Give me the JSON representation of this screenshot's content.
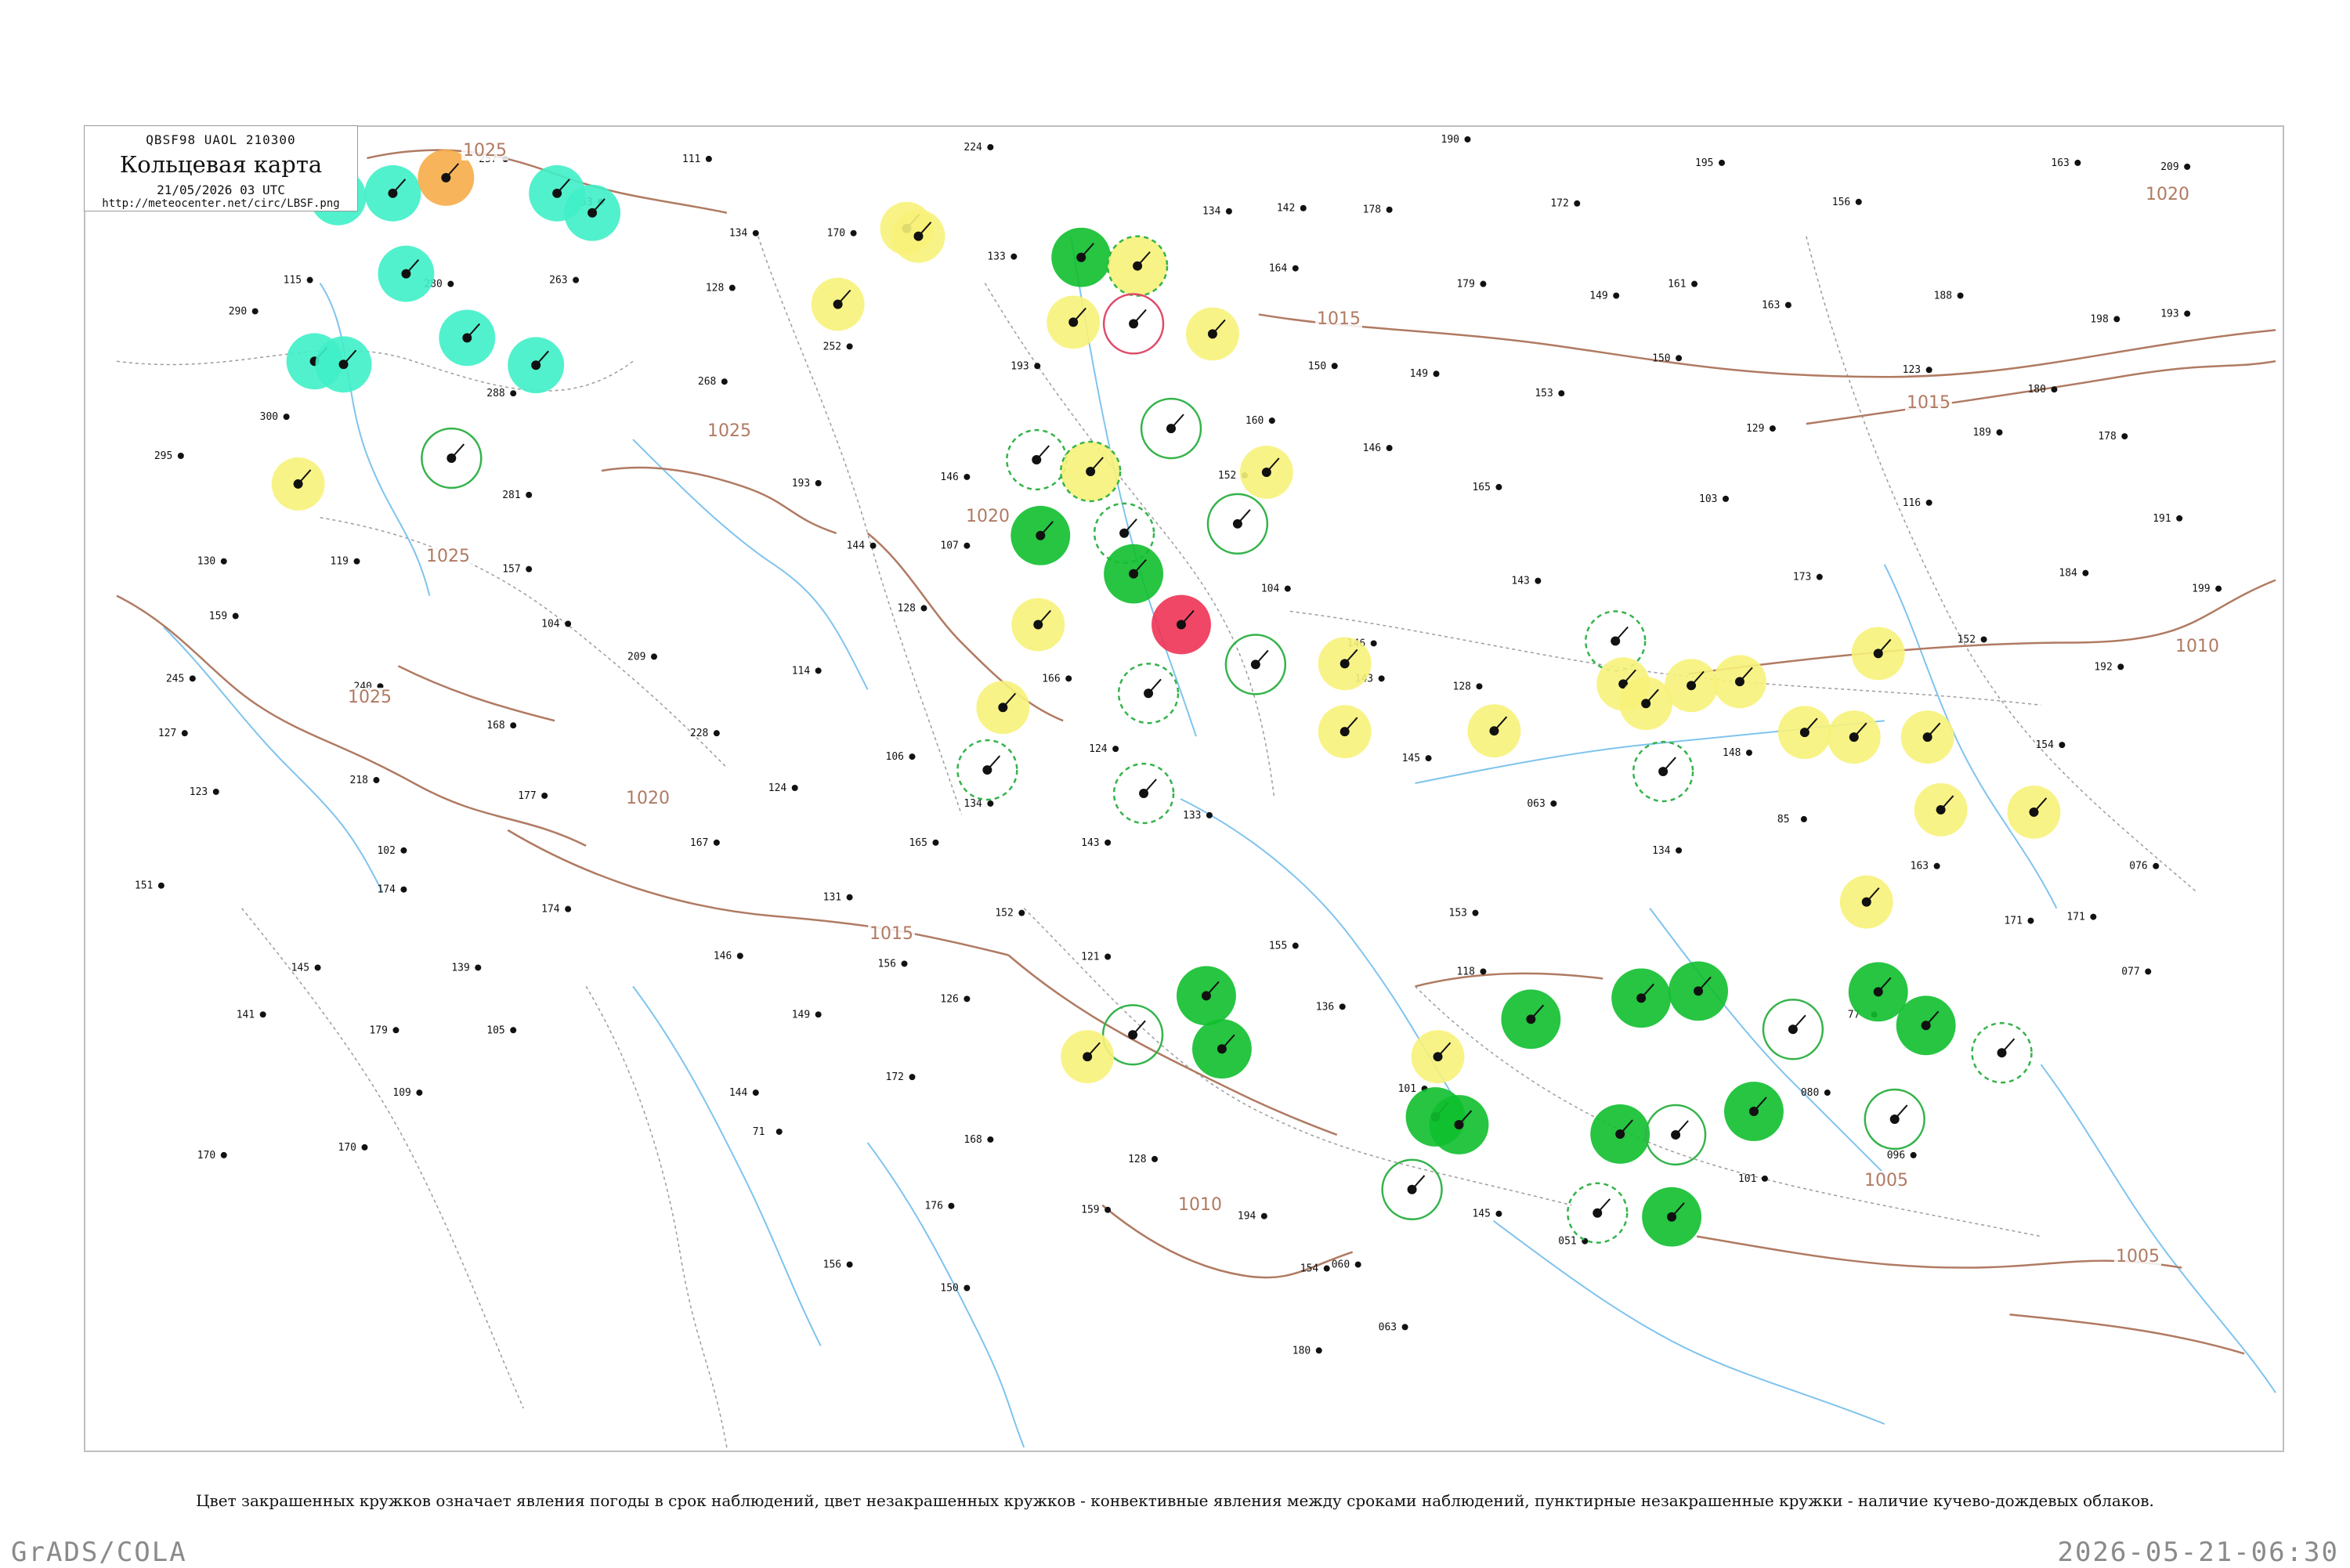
{
  "header": {
    "code_line": "QBSF98  UAOL  210300",
    "title": "Кольцевая карта",
    "date_line": "21/05/2026 03 UTC",
    "url": "http://meteocenter.net/circ/LBSF.png"
  },
  "caption": "Цвет закрашенных кружков означает явления погоды в срок наблюдений, цвет незакрашенных кружков - конвективные явления между сроками наблюдений, пунктирные незакрашенные кружки - наличие кучево-дождевых облаков.",
  "footer": {
    "left": "GrADS/COLA",
    "right": "2026-05-21-06:30"
  },
  "colors": {
    "isobar": "#b07a62",
    "river": "#7fc4ee",
    "border": "#9c9c9c",
    "green_fill": "#0fbf2e",
    "yellow_fill": "#f7f27a",
    "teal_fill": "#3ff0c8",
    "orange_fill": "#f6ac48",
    "red_fill": "#ee3355",
    "green_ring": "#34b34a",
    "red_ring": "#e04a6a"
  },
  "isobars": [
    {
      "label": "1025"
    },
    {
      "label": "1025"
    },
    {
      "label": "1025"
    },
    {
      "label": "1025"
    },
    {
      "label": "1020"
    },
    {
      "label": "1020"
    },
    {
      "label": "1020"
    },
    {
      "label": "1015"
    },
    {
      "label": "1015"
    },
    {
      "label": "1015"
    },
    {
      "label": "1010"
    },
    {
      "label": "1010"
    },
    {
      "label": "1005"
    },
    {
      "label": "1005"
    }
  ],
  "station_markers": [
    {
      "lon": 430,
      "lat": 250,
      "kind": "teal"
    },
    {
      "lon": 500,
      "lat": 245,
      "kind": "teal"
    },
    {
      "lon": 568,
      "lat": 225,
      "kind": "orange"
    },
    {
      "lon": 710,
      "lat": 245,
      "kind": "teal"
    },
    {
      "lon": 755,
      "lat": 270,
      "kind": "teal"
    },
    {
      "lon": 517,
      "lat": 348,
      "kind": "teal"
    },
    {
      "lon": 400,
      "lat": 460,
      "kind": "teal"
    },
    {
      "lon": 437,
      "lat": 464,
      "kind": "teal"
    },
    {
      "lon": 595,
      "lat": 430,
      "kind": "teal"
    },
    {
      "lon": 683,
      "lat": 465,
      "kind": "teal"
    },
    {
      "lon": 575,
      "lat": 584,
      "kind": "green_ring"
    },
    {
      "lon": 379,
      "lat": 617,
      "kind": "yellow"
    },
    {
      "lon": 1069,
      "lat": 387,
      "kind": "yellow"
    },
    {
      "lon": 1157,
      "lat": 290,
      "kind": "yellow"
    },
    {
      "lon": 1172,
      "lat": 300,
      "kind": "yellow"
    },
    {
      "lon": 1380,
      "lat": 327,
      "kind": "green"
    },
    {
      "lon": 1452,
      "lat": 338,
      "kind": "yellow_ring"
    },
    {
      "lon": 1370,
      "lat": 410,
      "kind": "yellow"
    },
    {
      "lon": 1447,
      "lat": 412,
      "kind": "red_ring"
    },
    {
      "lon": 1548,
      "lat": 425,
      "kind": "yellow"
    },
    {
      "lon": 1495,
      "lat": 546,
      "kind": "green_ring"
    },
    {
      "lon": 1617,
      "lat": 602,
      "kind": "yellow"
    },
    {
      "lon": 1323,
      "lat": 586,
      "kind": "green_dash"
    },
    {
      "lon": 1392,
      "lat": 601,
      "kind": "yellow_ring"
    },
    {
      "lon": 1328,
      "lat": 683,
      "kind": "green"
    },
    {
      "lon": 1435,
      "lat": 680,
      "kind": "green_dash"
    },
    {
      "lon": 1447,
      "lat": 732,
      "kind": "green"
    },
    {
      "lon": 1580,
      "lat": 668,
      "kind": "green_ring"
    },
    {
      "lon": 1508,
      "lat": 797,
      "kind": "red"
    },
    {
      "lon": 1325,
      "lat": 797,
      "kind": "yellow"
    },
    {
      "lon": 1280,
      "lat": 903,
      "kind": "yellow"
    },
    {
      "lon": 1466,
      "lat": 885,
      "kind": "green_dash"
    },
    {
      "lon": 1603,
      "lat": 848,
      "kind": "green_ring"
    },
    {
      "lon": 1717,
      "lat": 847,
      "kind": "yellow"
    },
    {
      "lon": 1717,
      "lat": 934,
      "kind": "yellow"
    },
    {
      "lon": 1908,
      "lat": 933,
      "kind": "yellow"
    },
    {
      "lon": 2063,
      "lat": 818,
      "kind": "green_dash"
    },
    {
      "lon": 2073,
      "lat": 873,
      "kind": "yellow"
    },
    {
      "lon": 2102,
      "lat": 898,
      "kind": "yellow"
    },
    {
      "lon": 2160,
      "lat": 875,
      "kind": "yellow"
    },
    {
      "lon": 2222,
      "lat": 870,
      "kind": "yellow"
    },
    {
      "lon": 2305,
      "lat": 935,
      "kind": "yellow"
    },
    {
      "lon": 2399,
      "lat": 834,
      "kind": "yellow"
    },
    {
      "lon": 2368,
      "lat": 941,
      "kind": "yellow"
    },
    {
      "lon": 2462,
      "lat": 941,
      "kind": "yellow"
    },
    {
      "lon": 2124,
      "lat": 985,
      "kind": "green_dash"
    },
    {
      "lon": 2598,
      "lat": 1037,
      "kind": "yellow"
    },
    {
      "lon": 2479,
      "lat": 1034,
      "kind": "yellow"
    },
    {
      "lon": 1260,
      "lat": 983,
      "kind": "green_dash"
    },
    {
      "lon": 1460,
      "lat": 1013,
      "kind": "green_dash"
    },
    {
      "lon": 2384,
      "lat": 1152,
      "kind": "yellow"
    },
    {
      "lon": 1540,
      "lat": 1272,
      "kind": "green"
    },
    {
      "lon": 1560,
      "lat": 1340,
      "kind": "green"
    },
    {
      "lon": 1446,
      "lat": 1322,
      "kind": "green_ring"
    },
    {
      "lon": 1388,
      "lat": 1350,
      "kind": "yellow"
    },
    {
      "lon": 1836,
      "lat": 1350,
      "kind": "yellow"
    },
    {
      "lon": 1955,
      "lat": 1302,
      "kind": "green"
    },
    {
      "lon": 2096,
      "lat": 1275,
      "kind": "green"
    },
    {
      "lon": 2169,
      "lat": 1266,
      "kind": "green"
    },
    {
      "lon": 2399,
      "lat": 1267,
      "kind": "green"
    },
    {
      "lon": 2460,
      "lat": 1310,
      "kind": "green"
    },
    {
      "lon": 2557,
      "lat": 1345,
      "kind": "green_dash"
    },
    {
      "lon": 2290,
      "lat": 1315,
      "kind": "green_ring"
    },
    {
      "lon": 1833,
      "lat": 1427,
      "kind": "green"
    },
    {
      "lon": 1863,
      "lat": 1437,
      "kind": "green"
    },
    {
      "lon": 2240,
      "lat": 1420,
      "kind": "green"
    },
    {
      "lon": 2069,
      "lat": 1449,
      "kind": "green"
    },
    {
      "lon": 2140,
      "lat": 1450,
      "kind": "green_ring"
    },
    {
      "lon": 2420,
      "lat": 1430,
      "kind": "green_ring"
    },
    {
      "lon": 1803,
      "lat": 1520,
      "kind": "green_ring"
    },
    {
      "lon": 2040,
      "lat": 1550,
      "kind": "green_dash"
    },
    {
      "lon": 2135,
      "lat": 1555,
      "kind": "green"
    }
  ],
  "station_labels": [
    {
      "lon": 610,
      "lat": 205,
      "text": "257"
    },
    {
      "lon": 732,
      "lat": 260,
      "text": "263"
    },
    {
      "lon": 870,
      "lat": 205,
      "text": "111"
    },
    {
      "lon": 1230,
      "lat": 190,
      "text": "224"
    },
    {
      "lon": 1840,
      "lat": 180,
      "text": "190"
    },
    {
      "lon": 2165,
      "lat": 210,
      "text": "195"
    },
    {
      "lon": 2620,
      "lat": 210,
      "text": "163"
    },
    {
      "lon": 2760,
      "lat": 215,
      "text": "209"
    },
    {
      "lon": 1535,
      "lat": 272,
      "text": "134"
    },
    {
      "lon": 1630,
      "lat": 268,
      "text": "142"
    },
    {
      "lon": 1740,
      "lat": 270,
      "text": "178"
    },
    {
      "lon": 1980,
      "lat": 262,
      "text": "172"
    },
    {
      "lon": 2340,
      "lat": 260,
      "text": "156"
    },
    {
      "lon": 930,
      "lat": 300,
      "text": "134"
    },
    {
      "lon": 1055,
      "lat": 300,
      "text": "170"
    },
    {
      "lon": 1260,
      "lat": 330,
      "text": "133"
    },
    {
      "lon": 360,
      "lat": 360,
      "text": "115"
    },
    {
      "lon": 540,
      "lat": 365,
      "text": "280"
    },
    {
      "lon": 700,
      "lat": 360,
      "text": "263"
    },
    {
      "lon": 900,
      "lat": 370,
      "text": "128"
    },
    {
      "lon": 1620,
      "lat": 345,
      "text": "164"
    },
    {
      "lon": 1860,
      "lat": 365,
      "text": "179"
    },
    {
      "lon": 2030,
      "lat": 380,
      "text": "149"
    },
    {
      "lon": 2130,
      "lat": 365,
      "text": "161"
    },
    {
      "lon": 2250,
      "lat": 392,
      "text": "163"
    },
    {
      "lon": 2470,
      "lat": 380,
      "text": "188"
    },
    {
      "lon": 2670,
      "lat": 410,
      "text": "198"
    },
    {
      "lon": 2760,
      "lat": 403,
      "text": "193"
    },
    {
      "lon": 290,
      "lat": 400,
      "text": "290"
    },
    {
      "lon": 1050,
      "lat": 445,
      "text": "252"
    },
    {
      "lon": 1290,
      "lat": 470,
      "text": "193"
    },
    {
      "lon": 1670,
      "lat": 470,
      "text": "150"
    },
    {
      "lon": 1800,
      "lat": 480,
      "text": "149"
    },
    {
      "lon": 1960,
      "lat": 505,
      "text": "153"
    },
    {
      "lon": 2110,
      "lat": 460,
      "text": "150"
    },
    {
      "lon": 2430,
      "lat": 475,
      "text": "123"
    },
    {
      "lon": 2590,
      "lat": 500,
      "text": "180"
    },
    {
      "lon": 330,
      "lat": 535,
      "text": "300"
    },
    {
      "lon": 620,
      "lat": 505,
      "text": "288"
    },
    {
      "lon": 890,
      "lat": 490,
      "text": "268"
    },
    {
      "lon": 1590,
      "lat": 540,
      "text": "160"
    },
    {
      "lon": 1740,
      "lat": 575,
      "text": "146"
    },
    {
      "lon": 2230,
      "lat": 550,
      "text": "129"
    },
    {
      "lon": 2520,
      "lat": 555,
      "text": "189"
    },
    {
      "lon": 2680,
      "lat": 560,
      "text": "178"
    },
    {
      "lon": 195,
      "lat": 585,
      "text": "295"
    },
    {
      "lon": 640,
      "lat": 635,
      "text": "281"
    },
    {
      "lon": 1010,
      "lat": 620,
      "text": "193"
    },
    {
      "lon": 1200,
      "lat": 612,
      "text": "146"
    },
    {
      "lon": 1555,
      "lat": 610,
      "text": "152"
    },
    {
      "lon": 1880,
      "lat": 625,
      "text": "165"
    },
    {
      "lon": 2170,
      "lat": 640,
      "text": "103"
    },
    {
      "lon": 2430,
      "lat": 645,
      "text": "116"
    },
    {
      "lon": 2750,
      "lat": 665,
      "text": "191"
    },
    {
      "lon": 250,
      "lat": 720,
      "text": "130"
    },
    {
      "lon": 420,
      "lat": 720,
      "text": "119"
    },
    {
      "lon": 640,
      "lat": 730,
      "text": "157"
    },
    {
      "lon": 1080,
      "lat": 700,
      "text": "144"
    },
    {
      "lon": 1200,
      "lat": 700,
      "text": "107"
    },
    {
      "lon": 1610,
      "lat": 755,
      "text": "104"
    },
    {
      "lon": 1930,
      "lat": 745,
      "text": "143"
    },
    {
      "lon": 2290,
      "lat": 740,
      "text": "173"
    },
    {
      "lon": 2630,
      "lat": 735,
      "text": "184"
    },
    {
      "lon": 2800,
      "lat": 755,
      "text": "199"
    },
    {
      "lon": 265,
      "lat": 790,
      "text": "159"
    },
    {
      "lon": 690,
      "lat": 800,
      "text": "104"
    },
    {
      "lon": 1145,
      "lat": 780,
      "text": "128"
    },
    {
      "lon": 1720,
      "lat": 825,
      "text": "146"
    },
    {
      "lon": 2500,
      "lat": 820,
      "text": "152"
    },
    {
      "lon": 2675,
      "lat": 855,
      "text": "192"
    },
    {
      "lon": 210,
      "lat": 870,
      "text": "245"
    },
    {
      "lon": 450,
      "lat": 880,
      "text": "240"
    },
    {
      "lon": 800,
      "lat": 842,
      "text": "209"
    },
    {
      "lon": 1010,
      "lat": 860,
      "text": "114"
    },
    {
      "lon": 1330,
      "lat": 870,
      "text": "166"
    },
    {
      "lon": 1730,
      "lat": 870,
      "text": "143"
    },
    {
      "lon": 1855,
      "lat": 880,
      "text": "128"
    },
    {
      "lon": 200,
      "lat": 940,
      "text": "127"
    },
    {
      "lon": 620,
      "lat": 930,
      "text": "168"
    },
    {
      "lon": 880,
      "lat": 940,
      "text": "228"
    },
    {
      "lon": 1130,
      "lat": 970,
      "text": "106"
    },
    {
      "lon": 1390,
      "lat": 960,
      "text": "124"
    },
    {
      "lon": 1790,
      "lat": 972,
      "text": "145"
    },
    {
      "lon": 2200,
      "lat": 965,
      "text": "148"
    },
    {
      "lon": 2600,
      "lat": 955,
      "text": "154"
    },
    {
      "lon": 240,
      "lat": 1015,
      "text": "123"
    },
    {
      "lon": 445,
      "lat": 1000,
      "text": "218"
    },
    {
      "lon": 660,
      "lat": 1020,
      "text": "177"
    },
    {
      "lon": 980,
      "lat": 1010,
      "text": "124"
    },
    {
      "lon": 1230,
      "lat": 1030,
      "text": "134"
    },
    {
      "lon": 1510,
      "lat": 1045,
      "text": "133"
    },
    {
      "lon": 1950,
      "lat": 1030,
      "text": "063"
    },
    {
      "lon": 2270,
      "lat": 1050,
      "text": "85"
    },
    {
      "lon": 2720,
      "lat": 1110,
      "text": "076"
    },
    {
      "lon": 480,
      "lat": 1090,
      "text": "102"
    },
    {
      "lon": 880,
      "lat": 1080,
      "text": "167"
    },
    {
      "lon": 1160,
      "lat": 1080,
      "text": "165"
    },
    {
      "lon": 1380,
      "lat": 1080,
      "text": "143"
    },
    {
      "lon": 2110,
      "lat": 1090,
      "text": "134"
    },
    {
      "lon": 2440,
      "lat": 1110,
      "text": "163"
    },
    {
      "lon": 170,
      "lat": 1135,
      "text": "151"
    },
    {
      "lon": 480,
      "lat": 1140,
      "text": "174"
    },
    {
      "lon": 690,
      "lat": 1165,
      "text": "174"
    },
    {
      "lon": 1050,
      "lat": 1150,
      "text": "131"
    },
    {
      "lon": 1270,
      "lat": 1170,
      "text": "152"
    },
    {
      "lon": 1850,
      "lat": 1170,
      "text": "153"
    },
    {
      "lon": 2560,
      "lat": 1180,
      "text": "171"
    },
    {
      "lon": 2640,
      "lat": 1175,
      "text": "171"
    },
    {
      "lon": 370,
      "lat": 1240,
      "text": "145"
    },
    {
      "lon": 575,
      "lat": 1240,
      "text": "139"
    },
    {
      "lon": 910,
      "lat": 1225,
      "text": "146"
    },
    {
      "lon": 1120,
      "lat": 1235,
      "text": "156"
    },
    {
      "lon": 1380,
      "lat": 1226,
      "text": "121"
    },
    {
      "lon": 1620,
      "lat": 1212,
      "text": "155"
    },
    {
      "lon": 1860,
      "lat": 1245,
      "text": "118"
    },
    {
      "lon": 2710,
      "lat": 1245,
      "text": "077"
    },
    {
      "lon": 300,
      "lat": 1300,
      "text": "141"
    },
    {
      "lon": 470,
      "lat": 1320,
      "text": "179"
    },
    {
      "lon": 620,
      "lat": 1320,
      "text": "105"
    },
    {
      "lon": 1010,
      "lat": 1300,
      "text": "149"
    },
    {
      "lon": 1200,
      "lat": 1280,
      "text": "126"
    },
    {
      "lon": 1680,
      "lat": 1290,
      "text": "136"
    },
    {
      "lon": 2360,
      "lat": 1300,
      "text": "77"
    },
    {
      "lon": 500,
      "lat": 1400,
      "text": "109"
    },
    {
      "lon": 930,
      "lat": 1400,
      "text": "144"
    },
    {
      "lon": 1130,
      "lat": 1380,
      "text": "172"
    },
    {
      "lon": 1785,
      "lat": 1395,
      "text": "101"
    },
    {
      "lon": 2300,
      "lat": 1400,
      "text": "080"
    },
    {
      "lon": 250,
      "lat": 1480,
      "text": "170"
    },
    {
      "lon": 430,
      "lat": 1470,
      "text": "170"
    },
    {
      "lon": 960,
      "lat": 1450,
      "text": "71"
    },
    {
      "lon": 1230,
      "lat": 1460,
      "text": "168"
    },
    {
      "lon": 1440,
      "lat": 1485,
      "text": "128"
    },
    {
      "lon": 2220,
      "lat": 1510,
      "text": "101"
    },
    {
      "lon": 2410,
      "lat": 1480,
      "text": "096"
    },
    {
      "lon": 1180,
      "lat": 1545,
      "text": "176"
    },
    {
      "lon": 1380,
      "lat": 1550,
      "text": "159"
    },
    {
      "lon": 1580,
      "lat": 1558,
      "text": "194"
    },
    {
      "lon": 1880,
      "lat": 1555,
      "text": "145"
    },
    {
      "lon": 1050,
      "lat": 1620,
      "text": "156"
    },
    {
      "lon": 1200,
      "lat": 1650,
      "text": "150"
    },
    {
      "lon": 1660,
      "lat": 1625,
      "text": "154"
    },
    {
      "lon": 1700,
      "lat": 1620,
      "text": "060"
    },
    {
      "lon": 1990,
      "lat": 1590,
      "text": "051"
    },
    {
      "lon": 1650,
      "lat": 1730,
      "text": "180"
    },
    {
      "lon": 1760,
      "lat": 1700,
      "text": "063"
    }
  ]
}
